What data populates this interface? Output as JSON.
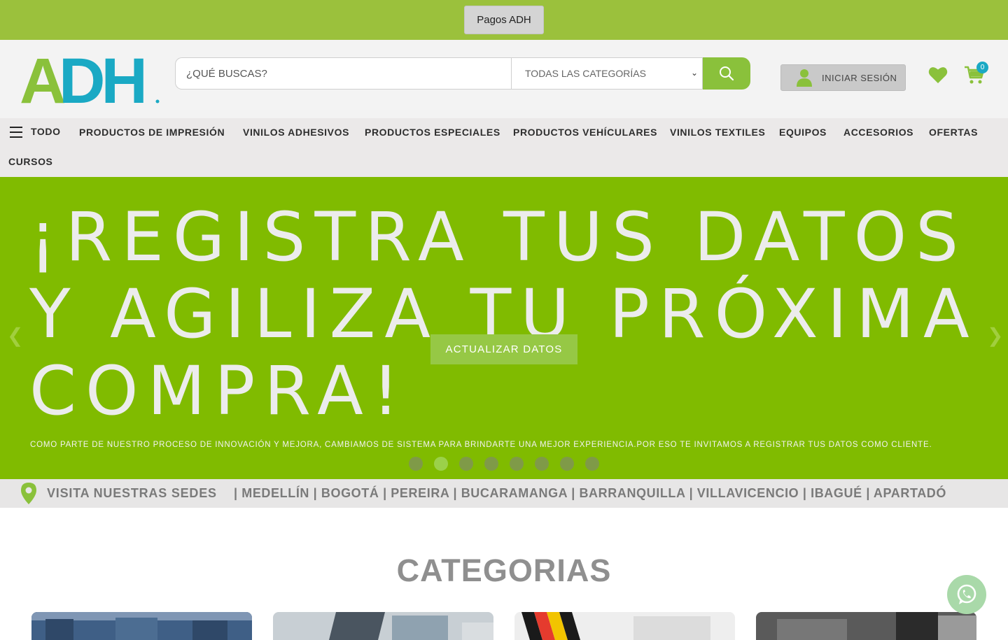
{
  "topbar": {
    "pagos_label": "Pagos ADH"
  },
  "header": {
    "logo_text": "ADH",
    "search_placeholder": "¿QUÉ BUSCAS?",
    "category_select": "TODAS LAS CATEGORÍAS",
    "login_label": "INICIAR SESIÓN",
    "cart_count": "0"
  },
  "nav": {
    "menu_label": "TODO",
    "items": [
      "PRODUCTOS DE IMPRESIÓN",
      "VINILOS ADHESIVOS",
      "PRODUCTOS ESPECIALES",
      "PRODUCTOS VEHÍCULARES",
      "VINILOS TEXTILES",
      "EQUIPOS",
      "ACCESORIOS",
      "OFERTAS",
      "CURSOS"
    ]
  },
  "hero": {
    "line1": "¡REGISTRA TUS DATOS",
    "line2": "Y AGILIZA TU PRÓXIMA",
    "line3": "COMPRA!",
    "subtitle": "COMO PARTE DE NUESTRO PROCESO DE INNOVACIÓN Y MEJORA, CAMBIAMOS DE SISTEMA PARA BRINDARTE UNA MEJOR EXPERIENCIA.POR ESO TE INVITAMOS A REGISTRAR TUS DATOS COMO CLIENTE.",
    "cta_label": "ACTUALIZAR DATOS",
    "slide_count": 8,
    "active_slide": 2
  },
  "sedes": {
    "title": "VISITA NUESTRAS SEDES",
    "cities": "| MEDELLÍN | BOGOTÁ | PEREIRA | BUCARAMANGA | BARRANQUILLA | VILLAVICENCIO | IBAGUÉ | APARTADÓ"
  },
  "categories": {
    "title": "CATEGORIAS"
  },
  "colors": {
    "brand_green": "#8ac13b",
    "topbar_green": "#9bc13c",
    "hero_green": "#80bb00",
    "brand_blue": "#1aa9c4"
  }
}
